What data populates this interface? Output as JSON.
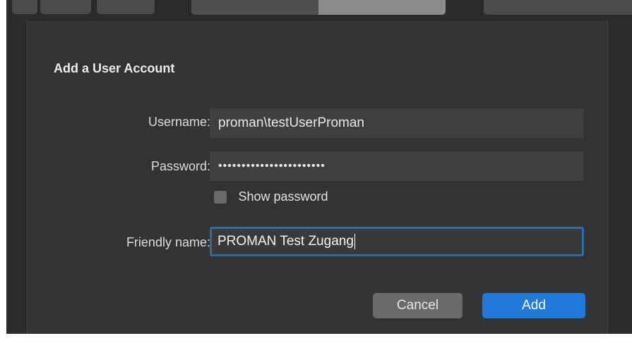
{
  "dialog": {
    "title": "Add a User Account",
    "username": {
      "label": "Username:",
      "value": "proman\\testUserProman"
    },
    "password": {
      "label": "Password:",
      "value": "•••••••••••••••••••••••"
    },
    "show_password": {
      "label": "Show password",
      "checked": false
    },
    "friendly_name": {
      "label": "Friendly name:",
      "value": "PROMAN Test Zugang"
    },
    "buttons": {
      "cancel": "Cancel",
      "add": "Add"
    }
  },
  "colors": {
    "background": "#2b2b2d",
    "sheet": "#333335",
    "field": "#3f3f41",
    "focus_ring": "#2b6ea6",
    "primary_button": "#1f7ad9",
    "secondary_button": "#6b6b6e"
  }
}
